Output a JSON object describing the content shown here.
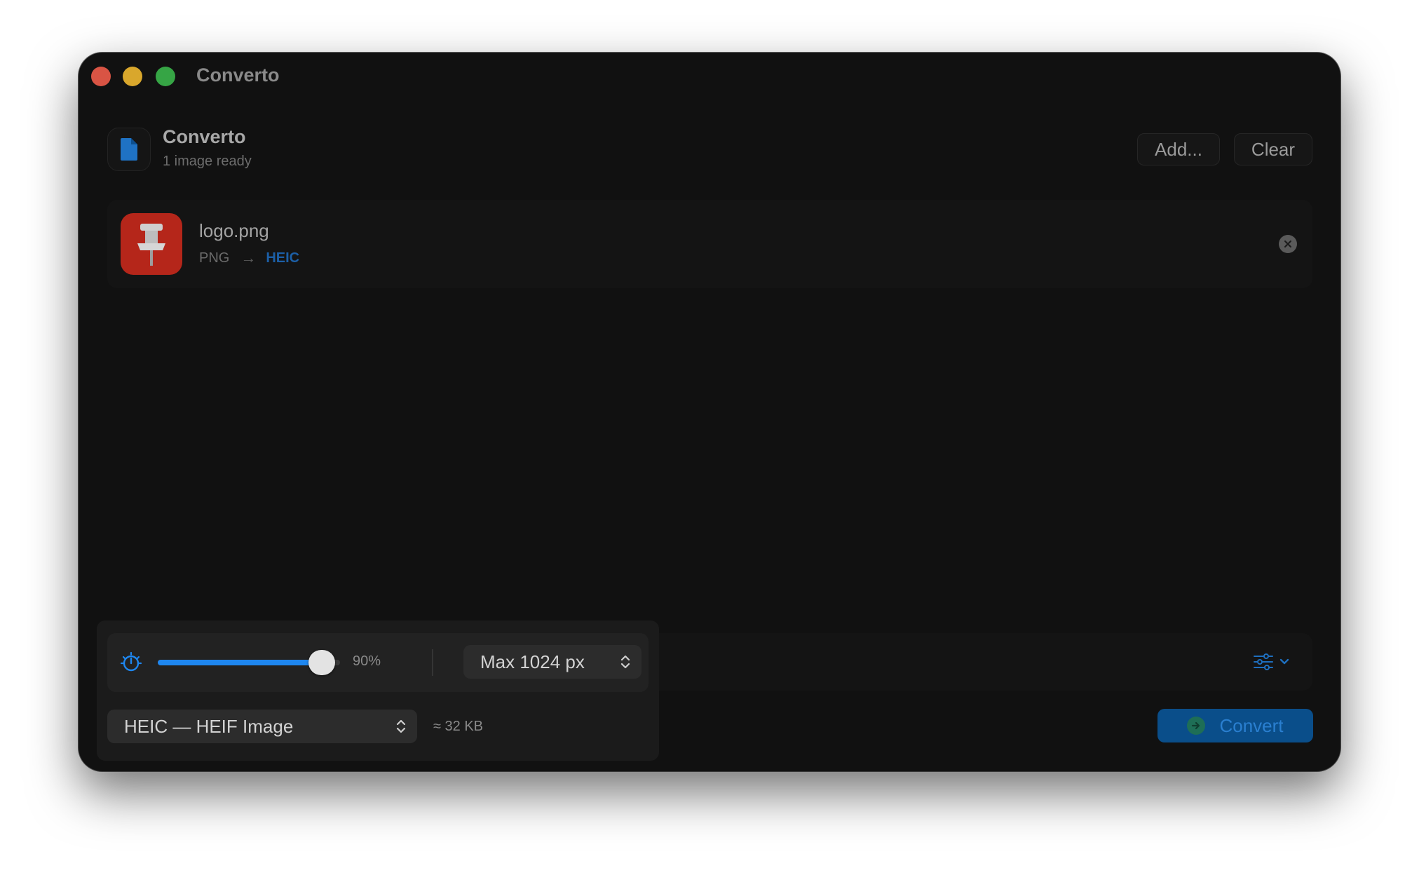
{
  "window": {
    "title": "Converto"
  },
  "header": {
    "app_name": "Converto",
    "subtitle": "1 image ready",
    "add_label": "Add...",
    "clear_label": "Clear",
    "icon": "document-icon"
  },
  "files": [
    {
      "name": "logo.png",
      "source_format": "PNG",
      "target_format": "HEIC",
      "thumbnail_icon": "pushpin-icon",
      "remove_icon": "close-circle-icon"
    }
  ],
  "options": {
    "quality_icon": "quality-dial-icon",
    "quality_value": 0.9,
    "quality_label": "90%",
    "max_size": {
      "selected": "Max 1024 px"
    },
    "output_format": {
      "selected": "HEIC — HEIF Image"
    },
    "estimated_size": "≈ 32 KB",
    "settings_icon": "sliders-icon"
  },
  "convert": {
    "label": "Convert",
    "icon": "arrow-right-circle-icon"
  },
  "colors": {
    "window_bg": "#111111",
    "accent": "#1e87f0",
    "convert_bg": "#0a4e8a",
    "target_format": "#1c5fa6",
    "thumbnail_bg": "#b5261a"
  }
}
